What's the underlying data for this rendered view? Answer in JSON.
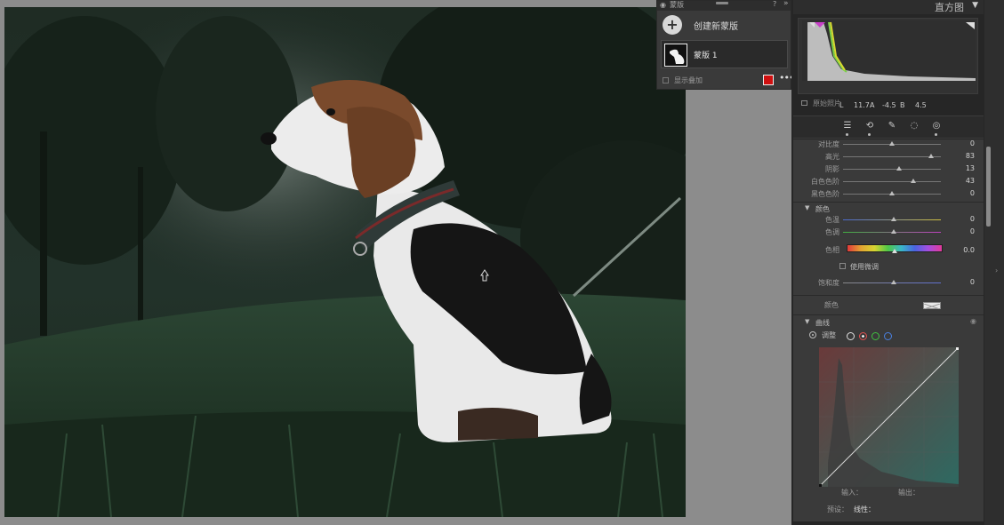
{
  "masks_panel": {
    "title": "蒙版",
    "create_label": "创建新蒙版",
    "mask_name": "蒙版 1",
    "show_overlay_label": "显示叠加",
    "overlay_color": "#d01010"
  },
  "histogram": {
    "title": "直方图",
    "L_label": "L",
    "L_value": "11.7",
    "A_label": "A",
    "A_value": "-4.5",
    "B_label": "B",
    "B_value": "4.5",
    "original_photo_label": "原始照片"
  },
  "sliders_top": [
    {
      "label": "对比度",
      "value": "0",
      "pos": 0.5
    },
    {
      "label": "高光",
      "value": "83",
      "pos": 0.9
    },
    {
      "label": "阴影",
      "value": "13",
      "pos": 0.57
    },
    {
      "label": "白色色阶",
      "value": "43",
      "pos": 0.72
    },
    {
      "label": "黑色色阶",
      "value": "0",
      "pos": 0.5
    }
  ],
  "color_section": {
    "title": "颜色",
    "temp_label": "色温",
    "temp_value": "0",
    "tint_label": "色调",
    "tint_value": "0",
    "hue_label": "色相",
    "hue_value": "0.0",
    "fine_adjust_label": "使用微调",
    "saturation_label": "饱和度",
    "saturation_value": "0",
    "color_label": "颜色"
  },
  "curve_section": {
    "title": "曲线",
    "adjust_label": "调整",
    "input_label": "输入：",
    "output_label": "输出：",
    "preset_label": "预设：",
    "preset_value": "线性："
  }
}
